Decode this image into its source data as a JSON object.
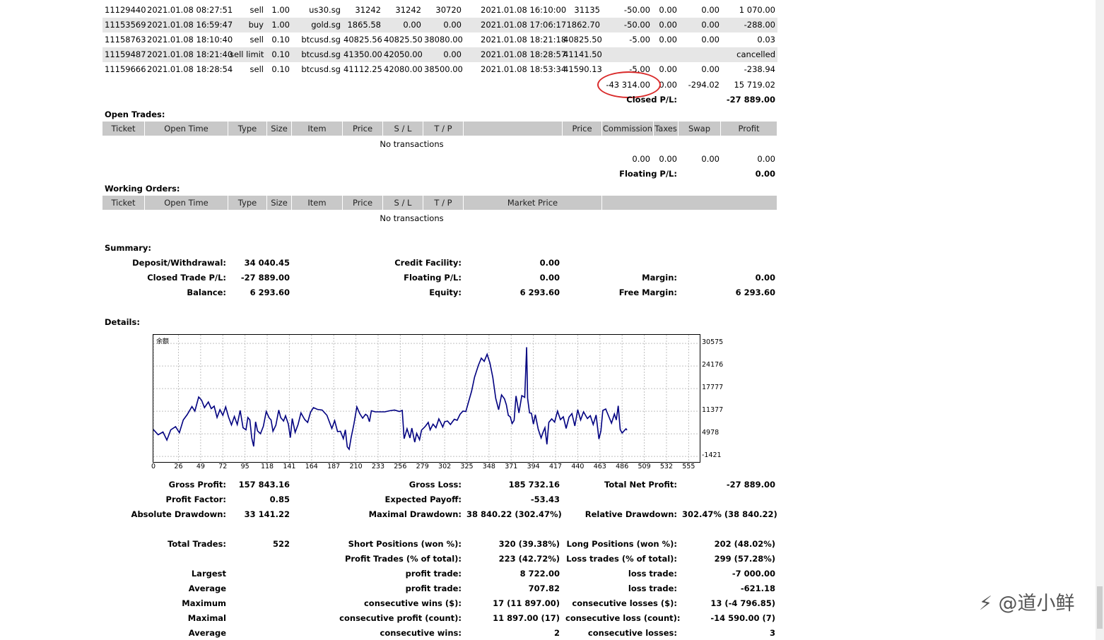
{
  "closed_trades": [
    {
      "ticket": "11129440",
      "open_time": "2021.01.08 08:27:51",
      "type": "sell",
      "size": "1.00",
      "item": "us30.sg",
      "price": "31242",
      "sl": "31242",
      "tp": "30720",
      "close_time": "2021.01.08 16:10:00",
      "close_price": "31135",
      "commission": "-50.00",
      "taxes": "0.00",
      "swap": "0.00",
      "profit": "1 070.00"
    },
    {
      "ticket": "11153569",
      "open_time": "2021.01.08 16:59:47",
      "type": "buy",
      "size": "1.00",
      "item": "gold.sg",
      "price": "1865.58",
      "sl": "0.00",
      "tp": "0.00",
      "close_time": "2021.01.08 17:06:17",
      "close_price": "1862.70",
      "commission": "-50.00",
      "taxes": "0.00",
      "swap": "0.00",
      "profit": "-288.00"
    },
    {
      "ticket": "11158763",
      "open_time": "2021.01.08 18:10:40",
      "type": "sell",
      "size": "0.10",
      "item": "btcusd.sg",
      "price": "40825.56",
      "sl": "40825.50",
      "tp": "38080.00",
      "close_time": "2021.01.08 18:21:18",
      "close_price": "40825.50",
      "commission": "-5.00",
      "taxes": "0.00",
      "swap": "0.00",
      "profit": "0.03"
    },
    {
      "ticket": "11159487",
      "open_time": "2021.01.08 18:21:40",
      "type": "sell limit",
      "size": "0.10",
      "item": "btcusd.sg",
      "price": "41350.00",
      "sl": "42050.00",
      "tp": "0.00",
      "close_time": "2021.01.08 18:28:57",
      "close_price": "41141.50",
      "commission": "",
      "taxes": "",
      "swap": "",
      "profit": "cancelled"
    },
    {
      "ticket": "11159666",
      "open_time": "2021.01.08 18:28:54",
      "type": "sell",
      "size": "0.10",
      "item": "btcusd.sg",
      "price": "41112.25",
      "sl": "42080.00",
      "tp": "38500.00",
      "close_time": "2021.01.08 18:53:34",
      "close_price": "41590.13",
      "commission": "-5.00",
      "taxes": "0.00",
      "swap": "0.00",
      "profit": "-238.94"
    }
  ],
  "closed_totals": {
    "commission": "-43 314.00",
    "taxes": "0.00",
    "swap": "-294.02",
    "profit": "15 719.02",
    "pl_label": "Closed P/L:",
    "pl_value": "-27 889.00"
  },
  "open_trades": {
    "title": "Open Trades:",
    "headers": [
      "Ticket",
      "Open Time",
      "Type",
      "Size",
      "Item",
      "Price",
      "S / L",
      "T / P",
      "",
      "Price",
      "Commission",
      "Taxes",
      "Swap",
      "Profit"
    ],
    "empty": "No transactions",
    "totals": {
      "commission": "0.00",
      "taxes": "0.00",
      "swap": "0.00",
      "profit": "0.00"
    },
    "pl_label": "Floating P/L:",
    "pl_value": "0.00"
  },
  "working_orders": {
    "title": "Working Orders:",
    "headers": [
      "Ticket",
      "Open Time",
      "Type",
      "Size",
      "Item",
      "Price",
      "S / L",
      "T / P",
      "Market Price",
      ""
    ],
    "empty": "No transactions"
  },
  "summary": {
    "title": "Summary:",
    "deposit_label": "Deposit/Withdrawal:",
    "deposit": "34 040.45",
    "credit_label": "Credit Facility:",
    "credit": "0.00",
    "closed_label": "Closed Trade P/L:",
    "closed": "-27 889.00",
    "floating_label": "Floating P/L:",
    "floating": "0.00",
    "margin_label": "Margin:",
    "margin": "0.00",
    "balance_label": "Balance:",
    "balance": "6 293.60",
    "equity_label": "Equity:",
    "equity": "6 293.60",
    "free_margin_label": "Free Margin:",
    "free_margin": "6 293.60"
  },
  "details": {
    "title": "Details:",
    "chart_legend": "余额",
    "rows": [
      [
        {
          "l": "Gross Profit:",
          "v": "157 843.16"
        },
        {
          "l": "Gross Loss:",
          "v": "185 732.16"
        },
        {
          "l": "Total Net Profit:",
          "v": "-27 889.00"
        }
      ],
      [
        {
          "l": "Profit Factor:",
          "v": "0.85"
        },
        {
          "l": "Expected Payoff:",
          "v": "-53.43"
        },
        {
          "l": "",
          "v": ""
        }
      ],
      [
        {
          "l": "Absolute Drawdown:",
          "v": "33 141.22"
        },
        {
          "l": "Maximal Drawdown:",
          "v": "38 840.22 (302.47%)"
        },
        {
          "l": "Relative Drawdown:",
          "v": "302.47% (38 840.22)"
        }
      ],
      [
        {
          "l": "Total Trades:",
          "v": "522"
        },
        {
          "l": "Short Positions (won %):",
          "v": "320 (39.38%)"
        },
        {
          "l": "Long Positions (won %):",
          "v": "202 (48.02%)"
        }
      ],
      [
        {
          "l": "",
          "v": ""
        },
        {
          "l": "Profit Trades (% of total):",
          "v": "223 (42.72%)"
        },
        {
          "l": "Loss trades (% of total):",
          "v": "299 (57.28%)"
        }
      ],
      [
        {
          "l": "Largest",
          "v": ""
        },
        {
          "l": "profit trade:",
          "v": "8 722.00"
        },
        {
          "l": "loss trade:",
          "v": "-7 000.00"
        }
      ],
      [
        {
          "l": "Average",
          "v": ""
        },
        {
          "l": "profit trade:",
          "v": "707.82"
        },
        {
          "l": "loss trade:",
          "v": "-621.18"
        }
      ],
      [
        {
          "l": "Maximum",
          "v": ""
        },
        {
          "l": "consecutive wins ($):",
          "v": "17 (11 897.00)"
        },
        {
          "l": "consecutive losses ($):",
          "v": "13 (-4 796.85)"
        }
      ],
      [
        {
          "l": "Maximal",
          "v": ""
        },
        {
          "l": "consecutive profit (count):",
          "v": "11 897.00 (17)"
        },
        {
          "l": "consecutive loss (count):",
          "v": "-14 590.00 (7)"
        }
      ],
      [
        {
          "l": "Average",
          "v": ""
        },
        {
          "l": "consecutive wins:",
          "v": "2"
        },
        {
          "l": "consecutive losses:",
          "v": "3"
        }
      ]
    ]
  },
  "chart_data": {
    "type": "line",
    "title": "",
    "series": [
      {
        "name": "余额",
        "color": "#000080"
      }
    ],
    "x_ticks": [
      "0",
      "26",
      "49",
      "72",
      "95",
      "118",
      "141",
      "164",
      "187",
      "210",
      "233",
      "256",
      "279",
      "302",
      "325",
      "348",
      "371",
      "394",
      "417",
      "440",
      "463",
      "486",
      "509",
      "532",
      "555"
    ],
    "y_ticks": [
      "30575",
      "24176",
      "17777",
      "11377",
      "4978",
      "-1421"
    ],
    "xlim": [
      0,
      565
    ],
    "ylim": [
      -2600,
      33000
    ],
    "points": [
      [
        0,
        6200
      ],
      [
        5,
        4700
      ],
      [
        10,
        5500
      ],
      [
        14,
        3200
      ],
      [
        18,
        6100
      ],
      [
        23,
        7000
      ],
      [
        27,
        5300
      ],
      [
        31,
        8900
      ],
      [
        35,
        10400
      ],
      [
        40,
        12700
      ],
      [
        43,
        11400
      ],
      [
        47,
        15400
      ],
      [
        50,
        14500
      ],
      [
        53,
        12400
      ],
      [
        57,
        14000
      ],
      [
        60,
        12100
      ],
      [
        63,
        12800
      ],
      [
        66,
        9600
      ],
      [
        69,
        11800
      ],
      [
        72,
        10200
      ],
      [
        75,
        12600
      ],
      [
        78,
        9700
      ],
      [
        81,
        7500
      ],
      [
        84,
        9900
      ],
      [
        87,
        7600
      ],
      [
        90,
        11600
      ],
      [
        93,
        6700
      ],
      [
        96,
        6100
      ],
      [
        98,
        9600
      ],
      [
        100,
        8900
      ],
      [
        102,
        3800
      ],
      [
        104,
        1400
      ],
      [
        106,
        8400
      ],
      [
        108,
        5800
      ],
      [
        111,
        5000
      ],
      [
        114,
        7100
      ],
      [
        117,
        11300
      ],
      [
        120,
        9500
      ],
      [
        122,
        8900
      ],
      [
        124,
        5700
      ],
      [
        127,
        7400
      ],
      [
        130,
        11700
      ],
      [
        132,
        9600
      ],
      [
        135,
        8600
      ],
      [
        137,
        10100
      ],
      [
        140,
        7700
      ],
      [
        142,
        3900
      ],
      [
        144,
        9300
      ],
      [
        147,
        5400
      ],
      [
        150,
        7600
      ],
      [
        153,
        10900
      ],
      [
        157,
        9000
      ],
      [
        160,
        8200
      ],
      [
        163,
        11100
      ],
      [
        166,
        12400
      ],
      [
        170,
        11900
      ],
      [
        175,
        11700
      ],
      [
        180,
        10200
      ],
      [
        185,
        6500
      ],
      [
        188,
        8700
      ],
      [
        191,
        5600
      ],
      [
        194,
        5700
      ],
      [
        197,
        3600
      ],
      [
        199,
        6100
      ],
      [
        201,
        1300
      ],
      [
        203,
        600
      ],
      [
        205,
        3800
      ],
      [
        208,
        7800
      ],
      [
        211,
        12600
      ],
      [
        214,
        10700
      ],
      [
        217,
        9400
      ],
      [
        220,
        10500
      ],
      [
        222,
        10100
      ],
      [
        224,
        8400
      ],
      [
        226,
        11500
      ],
      [
        230,
        11200
      ],
      [
        240,
        11200
      ],
      [
        245,
        11500
      ],
      [
        250,
        11700
      ],
      [
        255,
        11300
      ],
      [
        258,
        11600
      ],
      [
        260,
        3600
      ],
      [
        263,
        6400
      ],
      [
        266,
        3800
      ],
      [
        268,
        6600
      ],
      [
        271,
        2600
      ],
      [
        273,
        5100
      ],
      [
        276,
        3300
      ],
      [
        278,
        6000
      ],
      [
        282,
        7100
      ],
      [
        285,
        8200
      ],
      [
        287,
        6100
      ],
      [
        290,
        7700
      ],
      [
        293,
        6700
      ],
      [
        296,
        9200
      ],
      [
        298,
        8100
      ],
      [
        300,
        6900
      ],
      [
        302,
        8400
      ],
      [
        305,
        8600
      ],
      [
        308,
        7600
      ],
      [
        312,
        9100
      ],
      [
        315,
        8800
      ],
      [
        318,
        10500
      ],
      [
        321,
        11400
      ],
      [
        324,
        11300
      ],
      [
        327,
        14200
      ],
      [
        330,
        17100
      ],
      [
        333,
        21000
      ],
      [
        337,
        24400
      ],
      [
        340,
        26400
      ],
      [
        343,
        25500
      ],
      [
        346,
        27500
      ],
      [
        349,
        25000
      ],
      [
        352,
        20900
      ],
      [
        355,
        15000
      ],
      [
        358,
        11800
      ],
      [
        361,
        16000
      ],
      [
        364,
        14900
      ],
      [
        366,
        13200
      ],
      [
        368,
        10200
      ],
      [
        370,
        9800
      ],
      [
        372,
        7900
      ],
      [
        374,
        8800
      ],
      [
        376,
        15700
      ],
      [
        379,
        10900
      ],
      [
        382,
        15800
      ],
      [
        385,
        15300
      ],
      [
        387,
        29500
      ],
      [
        388,
        15000
      ],
      [
        390,
        10900
      ],
      [
        392,
        10800
      ],
      [
        394,
        7700
      ],
      [
        396,
        10400
      ],
      [
        399,
        6300
      ],
      [
        402,
        3800
      ],
      [
        404,
        5400
      ],
      [
        406,
        6700
      ],
      [
        408,
        2000
      ],
      [
        410,
        8200
      ],
      [
        413,
        9200
      ],
      [
        416,
        8300
      ],
      [
        419,
        11400
      ],
      [
        422,
        9000
      ],
      [
        425,
        9800
      ],
      [
        428,
        6500
      ],
      [
        431,
        9700
      ],
      [
        434,
        10700
      ],
      [
        437,
        7200
      ],
      [
        440,
        11800
      ],
      [
        443,
        8900
      ],
      [
        446,
        11200
      ],
      [
        450,
        9300
      ],
      [
        453,
        10100
      ],
      [
        456,
        7600
      ],
      [
        459,
        10300
      ],
      [
        462,
        3500
      ],
      [
        464,
        5800
      ],
      [
        466,
        11600
      ],
      [
        469,
        12000
      ],
      [
        472,
        10000
      ],
      [
        475,
        8000
      ],
      [
        478,
        10600
      ],
      [
        480,
        8900
      ],
      [
        482,
        12900
      ],
      [
        484,
        6200
      ],
      [
        486,
        5200
      ],
      [
        488,
        5800
      ],
      [
        490,
        6400
      ],
      [
        491,
        6000
      ]
    ]
  }
}
